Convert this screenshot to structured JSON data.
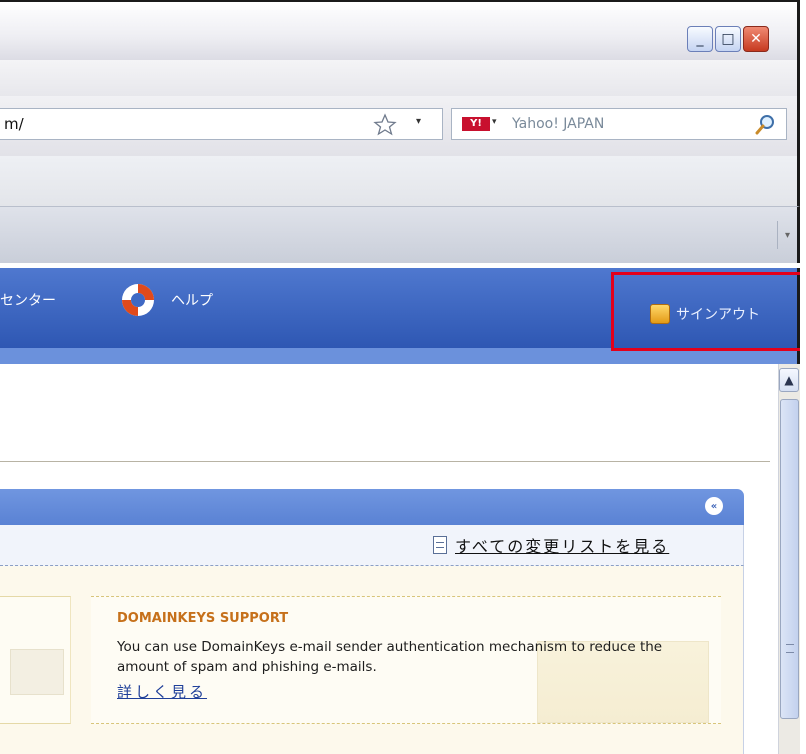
{
  "window": {
    "minimize_glyph": "_",
    "maximize_glyph": "□",
    "close_glyph": "✕"
  },
  "toolbar": {
    "address_value": "m/",
    "bookmark_icon": "star-icon",
    "search_provider_logo": "Y!",
    "search_placeholder": "Yahoo! JAPAN",
    "search_icon": "magnifier-icon",
    "dropdown_glyph": "▾"
  },
  "nav": {
    "center_label": "センター",
    "help_label": "ヘルプ",
    "signout_label": "サインアウト",
    "help_icon": "lifering-icon",
    "highlight_color": "#e3001b"
  },
  "panel": {
    "collapse_glyph": "«",
    "view_changes_link": "すべての変更リストを見る",
    "card": {
      "title": "DOMAINKEYS SUPPORT",
      "description": "You can use DomainKeys e-mail sender authentication mechanism to reduce the amount of spam and phishing e-mails.",
      "more_link": "詳しく見る"
    }
  },
  "scrollbar": {
    "up_glyph": "▲"
  },
  "colors": {
    "nav_blue": "#2e57b3",
    "panel_blue": "#5a82d4",
    "card_title": "#c6701a",
    "link_blue": "#1f3f99"
  }
}
